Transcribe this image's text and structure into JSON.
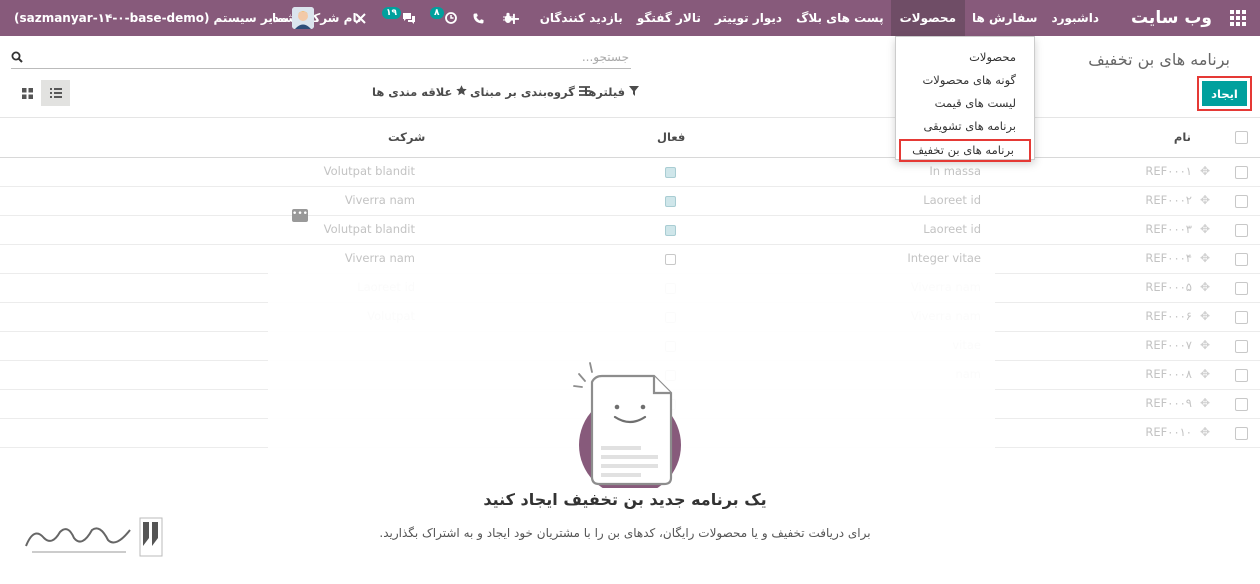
{
  "navbar": {
    "brand": "وب سایت",
    "menu": [
      "داشبورد",
      "سفارش ها",
      "محصولات",
      "پست های بلاگ",
      "دیوار توییتر",
      "تالار گفتگو",
      "بازدید کنندگان"
    ],
    "add_label": "+",
    "activity_count": "۸",
    "message_count": "۱۹",
    "company": "نام شرکت شما",
    "user": "مدیر سیستم",
    "database": "(sazmanyar-۱۴-۰-base-demo)"
  },
  "dropdown": {
    "items": [
      "محصولات",
      "گونه های محصولات",
      "لیست های قیمت",
      "برنامه های تشویقی",
      "برنامه های بن تخفیف"
    ]
  },
  "control_panel": {
    "title": "برنامه های بن تخفیف",
    "search_placeholder": "جستجو...",
    "create_label": "ایجاد",
    "filters_label": "فیلترها",
    "groupby_label": "گروه‌بندی بر مبنای",
    "favorites_label": "علاقه مندی ها"
  },
  "table": {
    "headers": {
      "name": "نام",
      "active": "فعال",
      "company": "شرکت"
    },
    "rows": [
      {
        "ref": "REF۰۰۰۱",
        "name": "In massa",
        "active": true,
        "company": "Volutpat blandit"
      },
      {
        "ref": "REF۰۰۰۲",
        "name": "Laoreet id",
        "active": true,
        "company": "Viverra nam"
      },
      {
        "ref": "REF۰۰۰۳",
        "name": "Laoreet id",
        "active": true,
        "company": "Volutpat blandit"
      },
      {
        "ref": "REF۰۰۰۴",
        "name": "Integer vitae",
        "active": false,
        "company": "Viverra nam"
      },
      {
        "ref": "REF۰۰۰۵",
        "name": "Viverra nam",
        "active": false,
        "company": "Laoreet id"
      },
      {
        "ref": "REF۰۰۰۶",
        "name": "Viverra nam",
        "active": false,
        "company": "Volutpat"
      },
      {
        "ref": "REF۰۰۰۷",
        "name": "vitae",
        "active": false,
        "company": ""
      },
      {
        "ref": "REF۰۰۰۸",
        "name": "nam",
        "active": false,
        "company": ""
      },
      {
        "ref": "REF۰۰۰۹",
        "name": "",
        "active": false,
        "company": ""
      },
      {
        "ref": "REF۰۰۱۰",
        "name": "",
        "active": false,
        "company": ""
      }
    ]
  },
  "help": {
    "title": "یک برنامه جدید بن تخفیف ایجاد کنید",
    "text": "برای دریافت تخفیف و یا محصولات رایگان، کدهای بن را با مشتریان خود ایجاد و به اشتراک بگذارید."
  },
  "colors": {
    "navbar": "#875a7b",
    "accent": "#00a09d",
    "highlight": "#e53935"
  },
  "icons": [
    "apps-icon",
    "bug-icon",
    "phone-icon",
    "clock-icon",
    "chat-icon",
    "close-icon",
    "search-icon",
    "filter-icon",
    "list-icon",
    "star-icon",
    "list-view-icon",
    "kanban-view-icon",
    "drag-handle-icon",
    "document-illustration"
  ]
}
